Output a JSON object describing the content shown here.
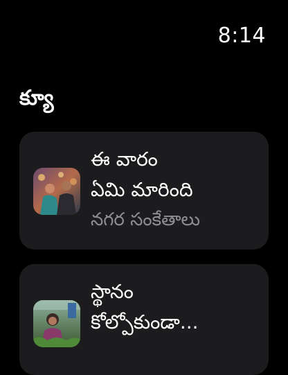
{
  "status_bar": {
    "time": "8:14"
  },
  "section": {
    "title": "క్యూ"
  },
  "queue": [
    {
      "title_line1": "ఈ వారం",
      "title_line2": "ఏమి మారింది",
      "subtitle": "నగర సంకేతాలు",
      "thumbnail_icon": "podcast-artwork-two-people"
    },
    {
      "title_line1": "స్థానం",
      "title_line2": "కోల్పోకుండా...",
      "subtitle": "",
      "thumbnail_icon": "podcast-artwork-woman-greenhouse"
    }
  ],
  "colors": {
    "background": "#000000",
    "card": "#1c1c1e",
    "secondary_text": "#8e8e93"
  }
}
